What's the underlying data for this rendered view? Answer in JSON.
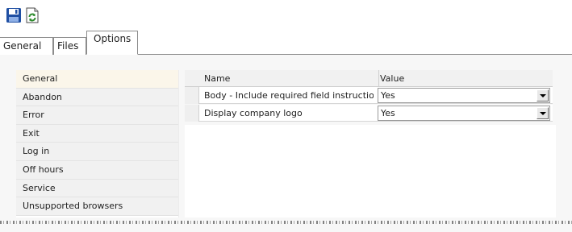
{
  "toolbar": {
    "buttons": [
      {
        "icon": "save-disk-icon"
      },
      {
        "icon": "refresh-icon"
      }
    ],
    "accent_save": "#1f4fa3",
    "accent_refresh": "#2c8a2c"
  },
  "tabs": [
    {
      "label": "General",
      "active": false
    },
    {
      "label": "Files",
      "active": false
    },
    {
      "label": "Options",
      "active": true
    }
  ],
  "sidebar": {
    "items": [
      {
        "label": "General",
        "active": true
      },
      {
        "label": "Abandon",
        "active": false
      },
      {
        "label": "Error",
        "active": false
      },
      {
        "label": "Exit",
        "active": false
      },
      {
        "label": "Log in",
        "active": false
      },
      {
        "label": "Off hours",
        "active": false
      },
      {
        "label": "Service",
        "active": false
      },
      {
        "label": "Unsupported browsers",
        "active": false
      }
    ]
  },
  "grid": {
    "columns": [
      "Name",
      "Value"
    ],
    "rows": [
      {
        "name": "Body - Include required field instructio...",
        "value": "Yes"
      },
      {
        "name": "Display company logo",
        "value": "Yes"
      }
    ]
  }
}
